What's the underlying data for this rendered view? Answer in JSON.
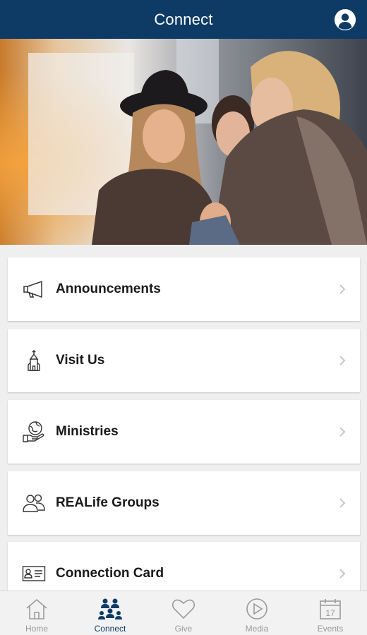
{
  "header": {
    "title": "Connect"
  },
  "colors": {
    "primary": "#0d3b66",
    "tab_inactive": "#9a9a9a",
    "background": "#efefef"
  },
  "menu": [
    {
      "label": "Announcements",
      "icon": "megaphone-icon"
    },
    {
      "label": "Visit Us",
      "icon": "church-icon"
    },
    {
      "label": "Ministries",
      "icon": "globe-hand-icon"
    },
    {
      "label": "REALife Groups",
      "icon": "people-icon"
    },
    {
      "label": "Connection Card",
      "icon": "id-card-icon"
    }
  ],
  "tabs": [
    {
      "label": "Home",
      "icon": "home-icon",
      "active": false
    },
    {
      "label": "Connect",
      "icon": "connect-people-icon",
      "active": true
    },
    {
      "label": "Give",
      "icon": "heart-icon",
      "active": false
    },
    {
      "label": "Media",
      "icon": "play-icon",
      "active": false
    },
    {
      "label": "Events",
      "icon": "calendar-icon",
      "active": false,
      "day": "17"
    }
  ]
}
